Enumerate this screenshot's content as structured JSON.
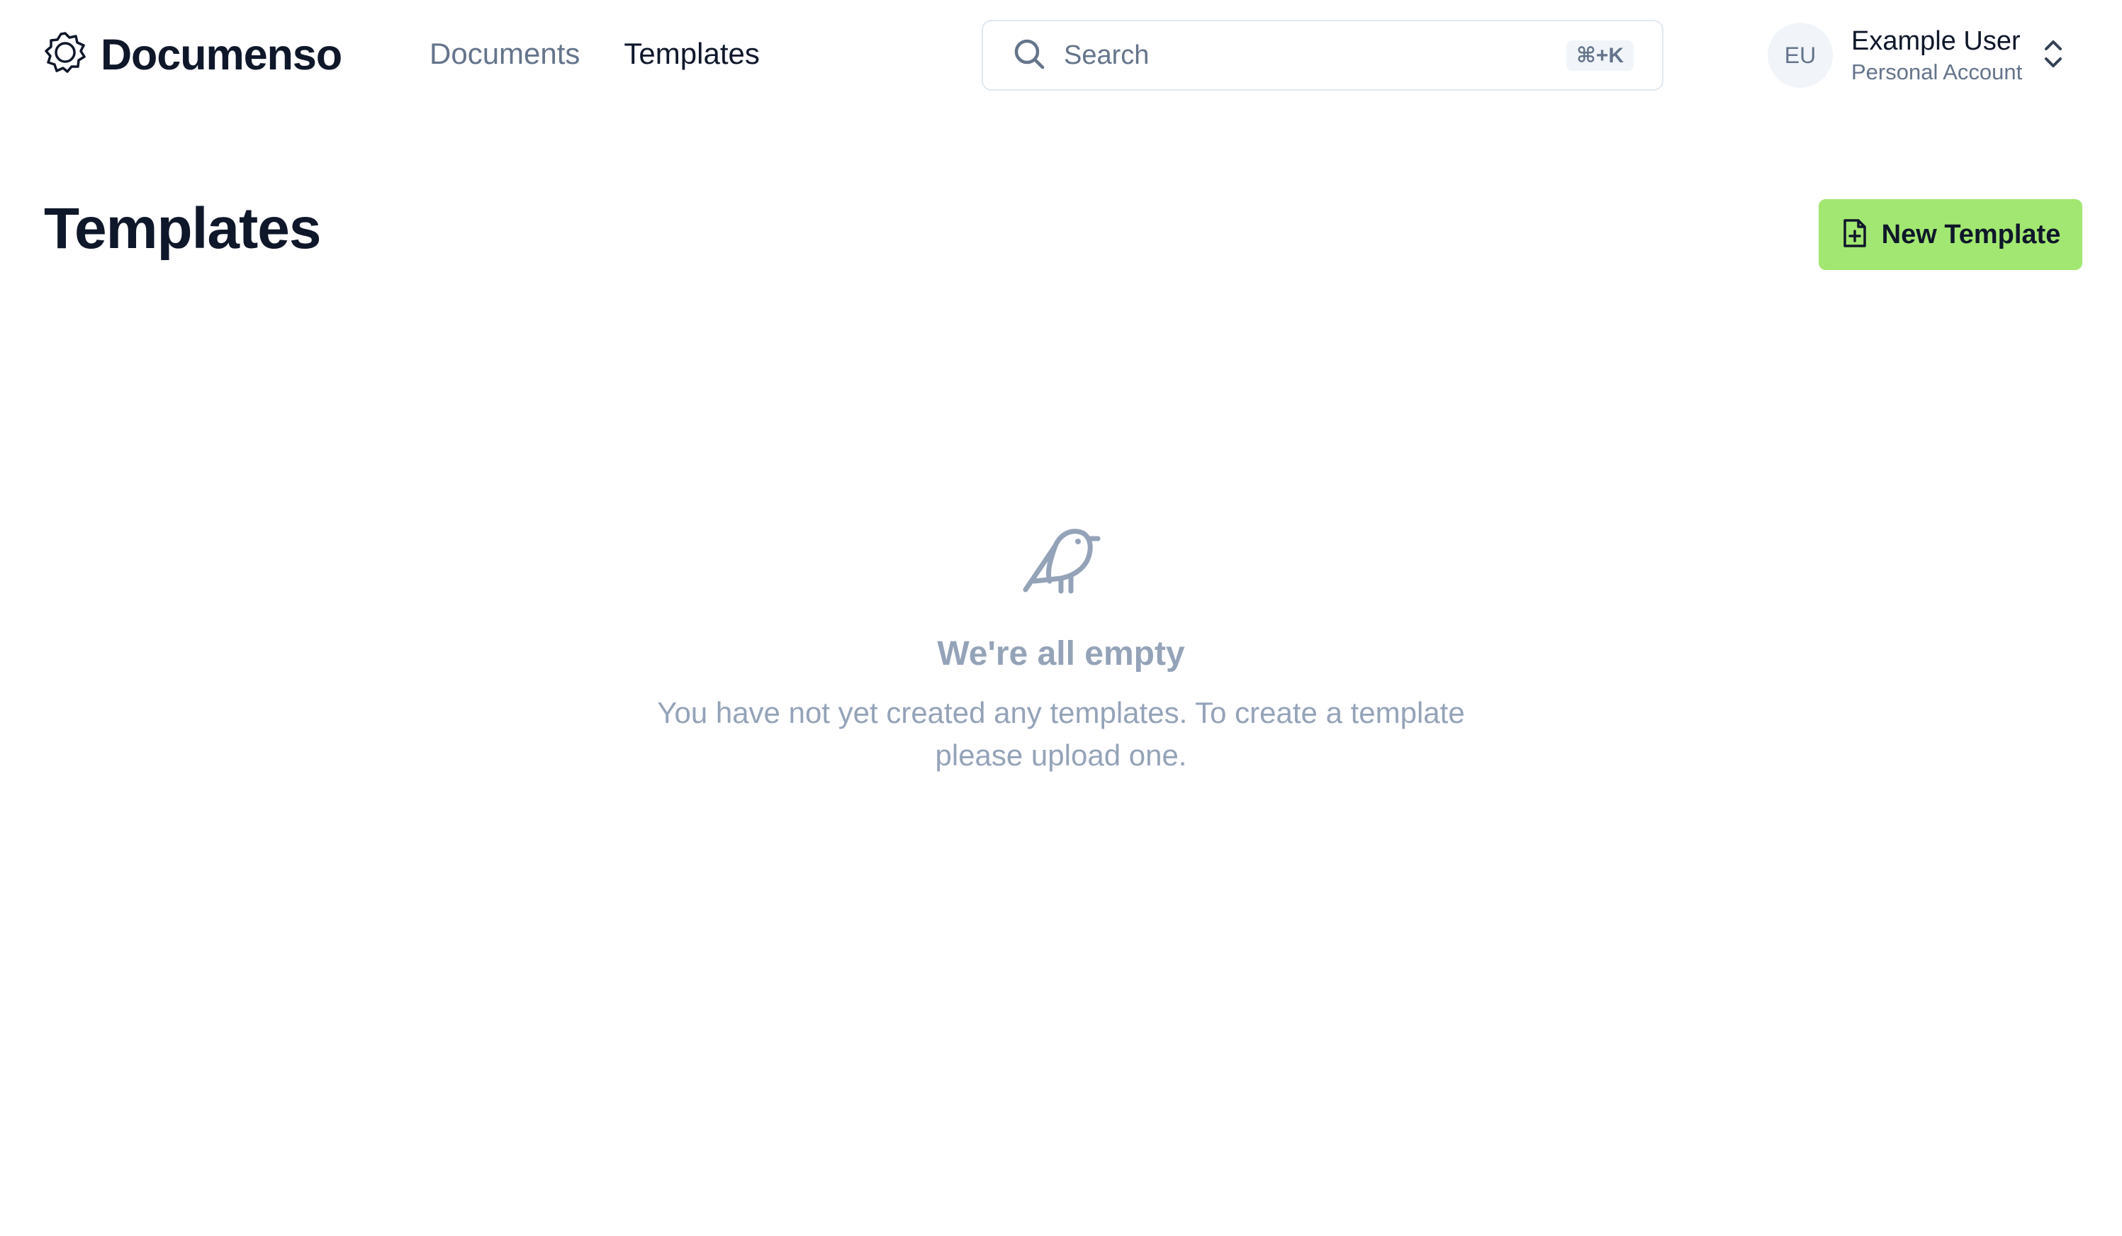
{
  "app": {
    "name": "Documenso",
    "logo_icon": "documenso-logo-icon"
  },
  "nav": {
    "items": [
      {
        "label": "Documents",
        "active": false
      },
      {
        "label": "Templates",
        "active": true
      }
    ]
  },
  "search": {
    "placeholder": "Search",
    "shortcut": "⌘+K",
    "icon": "search-icon"
  },
  "account": {
    "initials": "EU",
    "name": "Example User",
    "subtitle": "Personal Account",
    "switch_icon": "chevrons-up-down-icon"
  },
  "main": {
    "title": "Templates",
    "new_button": {
      "label": "New Template",
      "icon": "file-plus-icon",
      "color": "#a2e771"
    },
    "empty_state": {
      "icon": "bird-icon",
      "title": "We're all empty",
      "description": "You have not yet created any templates. To create a template please upload one."
    }
  },
  "colors": {
    "accent": "#a2e771",
    "muted": "#94a3b8",
    "text": "#0f172a"
  }
}
